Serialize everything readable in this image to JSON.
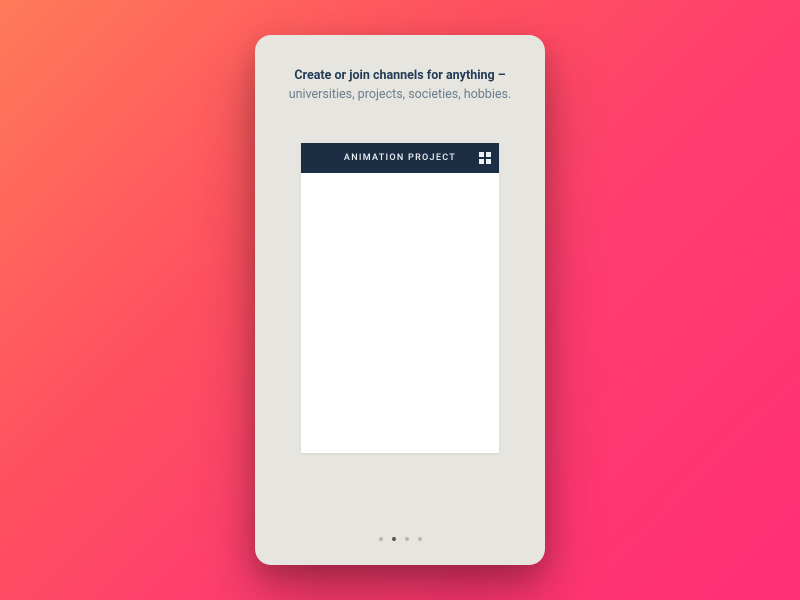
{
  "onboarding": {
    "headline_bold": "Create or join channels for anything –",
    "headline_light": "universities, projects, societies, hobbies."
  },
  "preview": {
    "channel_title": "ANIMATION PROJECT"
  },
  "pager": {
    "total": 4,
    "active_index": 1
  }
}
